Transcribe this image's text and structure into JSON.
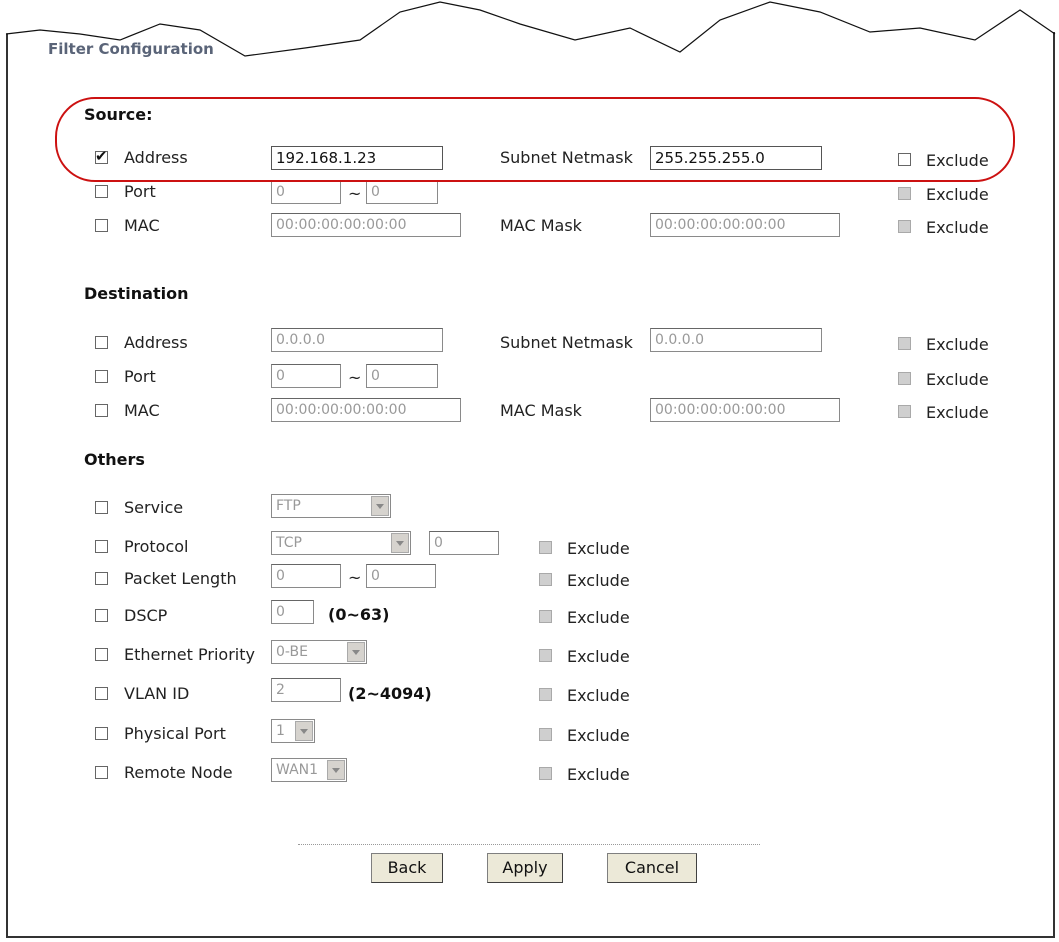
{
  "title": "Filter Configuration",
  "labels": {
    "exclude": "Exclude",
    "subnet_netmask": "Subnet Netmask",
    "mac_mask": "MAC Mask",
    "tilde": "~"
  },
  "source": {
    "heading": "Source:",
    "address": {
      "label": "Address",
      "checked": true,
      "value": "192.168.1.23",
      "netmask": "255.255.255.0"
    },
    "port": {
      "label": "Port",
      "from": "0",
      "to": "0"
    },
    "mac": {
      "label": "MAC",
      "value": "00:00:00:00:00:00",
      "mask": "00:00:00:00:00:00"
    }
  },
  "destination": {
    "heading": "Destination",
    "address": {
      "label": "Address",
      "value": "0.0.0.0",
      "netmask": "0.0.0.0"
    },
    "port": {
      "label": "Port",
      "from": "0",
      "to": "0"
    },
    "mac": {
      "label": "MAC",
      "value": "00:00:00:00:00:00",
      "mask": "00:00:00:00:00:00"
    }
  },
  "others": {
    "heading": "Others",
    "service": {
      "label": "Service",
      "selected": "FTP"
    },
    "protocol": {
      "label": "Protocol",
      "selected": "TCP",
      "value": "0"
    },
    "packet_length": {
      "label": "Packet Length",
      "from": "0",
      "to": "0"
    },
    "dscp": {
      "label": "DSCP",
      "value": "0",
      "range": "(0~63)"
    },
    "ethernet_priority": {
      "label": "Ethernet Priority",
      "selected": "0-BE"
    },
    "vlan_id": {
      "label": "VLAN ID",
      "value": "2",
      "range": "(2~4094)"
    },
    "physical_port": {
      "label": "Physical Port",
      "selected": "1"
    },
    "remote_node": {
      "label": "Remote Node",
      "selected": "WAN1"
    }
  },
  "buttons": {
    "back": "Back",
    "apply": "Apply",
    "cancel": "Cancel"
  },
  "colors": {
    "highlight": "#cc1111",
    "titlebar": "#dde3ea"
  }
}
